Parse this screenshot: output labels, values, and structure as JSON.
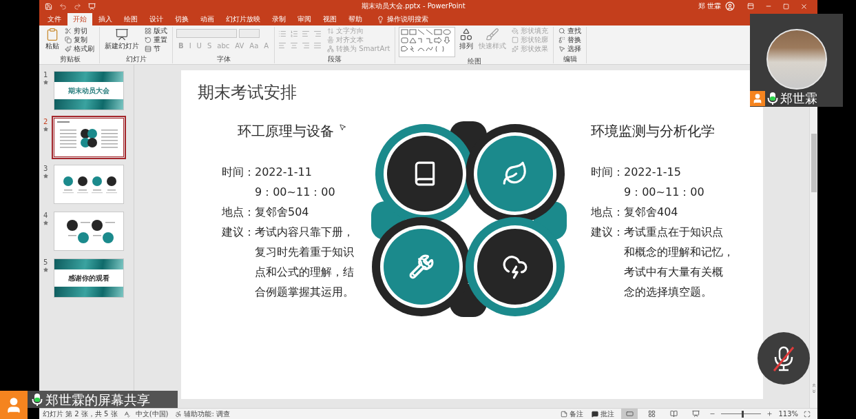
{
  "window": {
    "title": "期末动员大会.pptx - PowerPoint",
    "user": "郑 世霖"
  },
  "ribbon_tabs": [
    {
      "label": "文件",
      "selected": false
    },
    {
      "label": "开始",
      "selected": true
    },
    {
      "label": "插入",
      "selected": false
    },
    {
      "label": "绘图",
      "selected": false
    },
    {
      "label": "设计",
      "selected": false
    },
    {
      "label": "切换",
      "selected": false
    },
    {
      "label": "动画",
      "selected": false
    },
    {
      "label": "幻灯片放映",
      "selected": false
    },
    {
      "label": "录制",
      "selected": false
    },
    {
      "label": "审阅",
      "selected": false
    },
    {
      "label": "视图",
      "selected": false
    },
    {
      "label": "帮助",
      "selected": false
    }
  ],
  "tell_me": "操作说明搜索",
  "ribbon_groups": [
    {
      "label": "剪贴板",
      "kind": "plain",
      "items": [
        {
          "label": "粘贴",
          "kind": "large",
          "disabled": false
        },
        {
          "label": "剪切",
          "kind": "small",
          "disabled": false
        },
        {
          "label": "复制",
          "kind": "small",
          "disabled": false
        },
        {
          "label": "格式刷",
          "kind": "small",
          "disabled": false
        }
      ]
    },
    {
      "label": "幻灯片",
      "kind": "plain",
      "items": [
        {
          "label": "新建幻灯片",
          "kind": "large",
          "disabled": false
        },
        {
          "label": "版式",
          "kind": "small",
          "disabled": false
        },
        {
          "label": "重置",
          "kind": "small",
          "disabled": false
        },
        {
          "label": "节",
          "kind": "small",
          "disabled": false
        }
      ]
    },
    {
      "label": "字体",
      "kind": "font",
      "items": [
        {
          "label": "B",
          "kind": "glyph",
          "disabled": true
        },
        {
          "label": "I",
          "kind": "glyph",
          "disabled": true
        },
        {
          "label": "U",
          "kind": "glyph",
          "disabled": true
        },
        {
          "label": "S",
          "kind": "glyph",
          "disabled": true
        },
        {
          "label": "abc",
          "kind": "glyph",
          "disabled": true
        },
        {
          "label": "AV",
          "kind": "glyph",
          "disabled": true
        },
        {
          "label": "Aa",
          "kind": "glyph",
          "disabled": true
        },
        {
          "label": "A",
          "kind": "glyph",
          "disabled": true
        }
      ]
    },
    {
      "label": "段落",
      "kind": "paragraph",
      "items": [
        {
          "label": "文字方向",
          "kind": "small",
          "disabled": true
        },
        {
          "label": "对齐文本",
          "kind": "small",
          "disabled": true
        },
        {
          "label": "转换为 SmartArt",
          "kind": "small",
          "disabled": true
        }
      ]
    },
    {
      "label": "绘图",
      "kind": "drawing",
      "items": [
        {
          "label": "排列",
          "kind": "large",
          "disabled": false
        },
        {
          "label": "快速样式",
          "kind": "large",
          "disabled": true
        },
        {
          "label": "形状填充",
          "kind": "small",
          "disabled": true
        },
        {
          "label": "形状轮廓",
          "kind": "small",
          "disabled": true
        },
        {
          "label": "形状效果",
          "kind": "small",
          "disabled": true
        }
      ]
    },
    {
      "label": "编辑",
      "kind": "plain",
      "items": [
        {
          "label": "查找",
          "kind": "small",
          "disabled": false
        },
        {
          "label": "替换",
          "kind": "small",
          "disabled": false
        },
        {
          "label": "选择",
          "kind": "small",
          "disabled": false
        }
      ]
    }
  ],
  "slides": [
    {
      "number": "1",
      "selected": false,
      "kind": "cover",
      "title": "期末动员大会"
    },
    {
      "number": "2",
      "selected": true,
      "kind": "layout"
    },
    {
      "number": "3",
      "selected": false,
      "kind": "icons"
    },
    {
      "number": "4",
      "selected": false,
      "kind": "process"
    },
    {
      "number": "5",
      "selected": false,
      "kind": "cover",
      "title": "感谢你的观看"
    }
  ],
  "slide": {
    "title": "期末考试安排",
    "columns": [
      {
        "heading": "环工原理与设备",
        "details": [
          {
            "label": "时间：",
            "lines": [
              "2022-1-11",
              "9：00~11：00"
            ]
          },
          {
            "label": "地点：",
            "lines": [
              "复邻舍504"
            ]
          },
          {
            "label": "建议：",
            "lines": [
              "考试内容只靠下册，",
              "复习时先着重于知识",
              "点和公式的理解，结",
              "合例题掌握其运用。"
            ]
          }
        ]
      },
      {
        "heading": "环境监测与分析化学",
        "details": [
          {
            "label": "时间：",
            "lines": [
              "2022-1-15",
              "9：00~11：00"
            ]
          },
          {
            "label": "地点：",
            "lines": [
              "复邻舍404"
            ]
          },
          {
            "label": "建议：",
            "lines": [
              "考试重点在于知识点",
              "和概念的理解和记忆，",
              "考试中有大量有关概",
              "念的选择填空题。"
            ]
          }
        ]
      }
    ]
  },
  "status_bar": {
    "slide_info": "幻灯片 第 2 张，共 5 张",
    "language": "中文(中国)",
    "accessibility": "辅助功能: 调查",
    "notes": "备注",
    "comments": "批注",
    "views": [
      {
        "selected": true
      },
      {
        "selected": false
      },
      {
        "selected": false
      },
      {
        "selected": false
      }
    ],
    "zoom_slider": {
      "level": 0.52
    },
    "zoom": "113%"
  },
  "meeting": {
    "camera_name": "郑世霖",
    "share_label": "郑世霖的屏幕共享",
    "mic_muted": true
  }
}
